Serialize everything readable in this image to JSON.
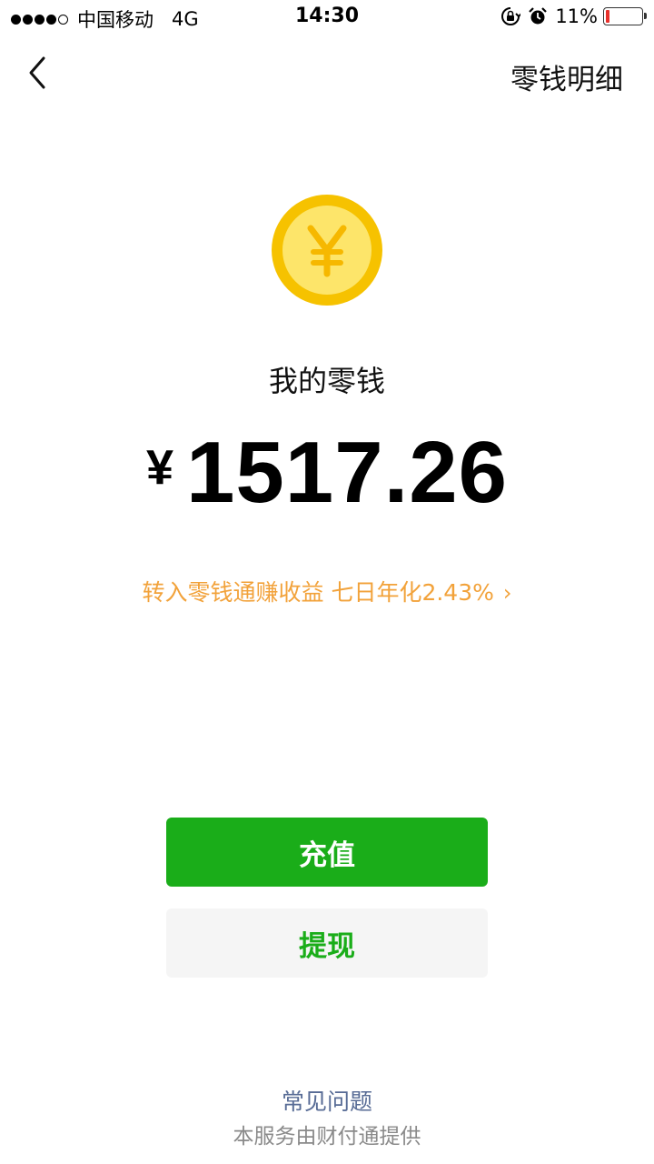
{
  "status_bar": {
    "carrier": "中国移动",
    "network": "4G",
    "time": "14:30",
    "battery_percent": "11%",
    "battery_level": 0.11,
    "signal_bars_filled": 4,
    "signal_bars_total": 5
  },
  "nav": {
    "title": "零钱明细",
    "back_icon": "chevron-left-icon"
  },
  "wallet": {
    "coin_icon": "yen-coin-icon",
    "label": "我的零钱",
    "currency_symbol": "¥",
    "balance": "1517.26",
    "promo_text": "转入零钱通赚收益 七日年化2.43%",
    "promo_chevron": "›"
  },
  "actions": {
    "recharge_label": "充值",
    "withdraw_label": "提现"
  },
  "footer": {
    "faq_label": "常见问题",
    "provider_text": "本服务由财付通提供"
  },
  "colors": {
    "accent_green": "#1aad19",
    "promo_orange": "#f2a23a",
    "link_blue": "#576b95",
    "coin_outer": "#f6c200",
    "coin_inner": "#fde56a"
  }
}
